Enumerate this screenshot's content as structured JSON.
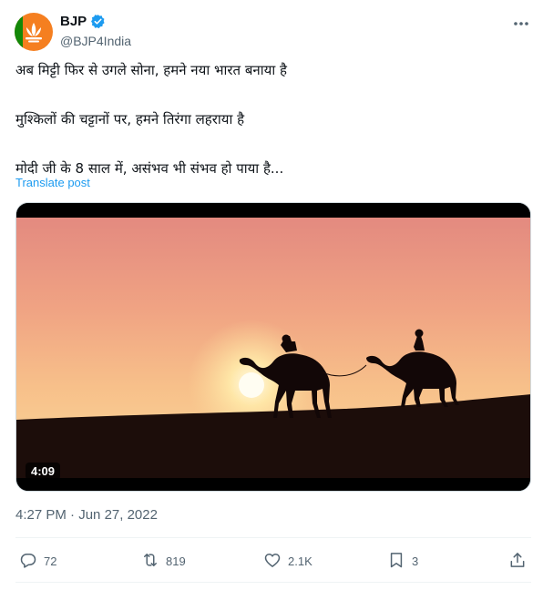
{
  "author": {
    "name": "BJP",
    "handle": "@BJP4India",
    "verified": true
  },
  "tweet": {
    "lines": [
      "अब मिट्टी फिर से उगले सोना, हमने नया भारत बनाया है",
      "मुश्किलों की चट्टानों पर, हमने तिरंगा लहराया है",
      "मोदी जी के 8 साल में, असंभव भी संभव हो पाया है..."
    ],
    "translate_label": "Translate post"
  },
  "media": {
    "type": "video",
    "duration": "4:09"
  },
  "meta": {
    "time": "4:27 PM",
    "separator": " · ",
    "date": "Jun 27, 2022"
  },
  "actions": {
    "replies": "72",
    "reposts": "819",
    "likes": "2.1K",
    "bookmarks": "3"
  },
  "colors": {
    "accent": "#1d9bf0",
    "secondary_text": "#536471",
    "brand_saffron": "#f57f20"
  },
  "icons": [
    "verified-badge-icon",
    "more-icon",
    "reply-icon",
    "repost-icon",
    "like-icon",
    "bookmark-icon",
    "share-icon"
  ]
}
